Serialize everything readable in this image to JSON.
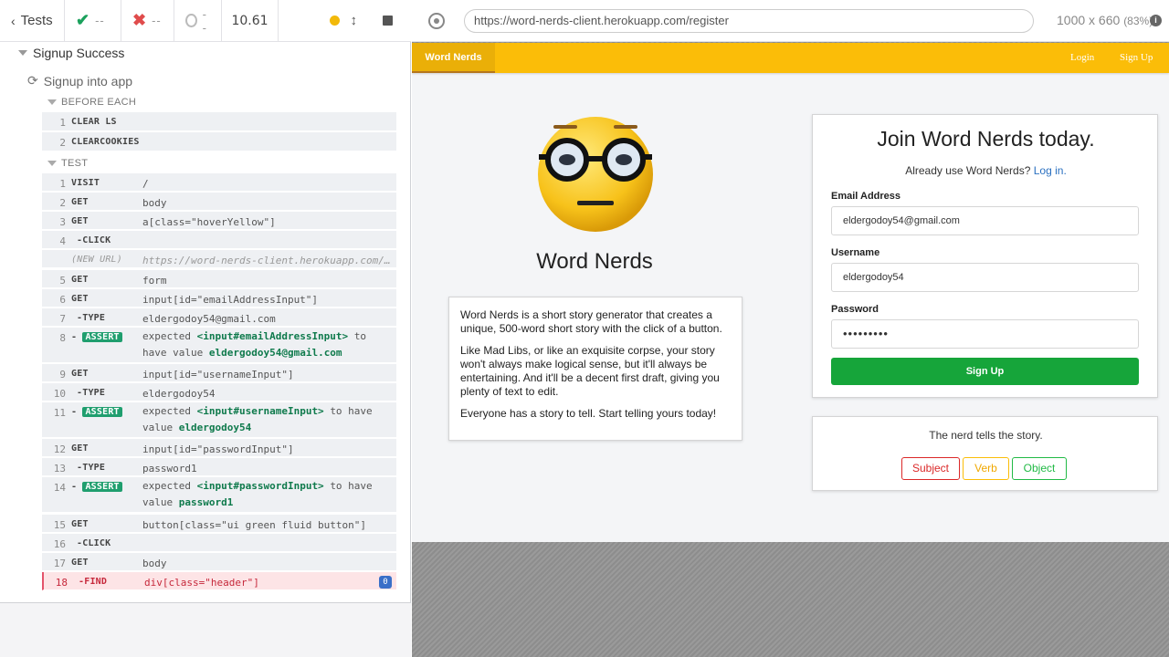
{
  "reporter": {
    "tests_label": "Tests",
    "passed": "--",
    "failed": "--",
    "pending": "--",
    "duration": "10.61",
    "suite_title": "Signup Success",
    "test_title": "Signup into app",
    "before_each_label": "BEFORE EACH",
    "test_label": "TEST",
    "before_each": [
      {
        "num": "1",
        "name": "CLEAR LS",
        "msg": ""
      },
      {
        "num": "2",
        "name": "CLEARCOOKIES",
        "msg": ""
      }
    ],
    "commands": [
      {
        "num": "1",
        "name": "VISIT",
        "msg": "/"
      },
      {
        "num": "2",
        "name": "GET",
        "msg": "body"
      },
      {
        "num": "3",
        "name": "GET",
        "msg": "a[class=\"hoverYellow\"]"
      },
      {
        "num": "4",
        "name": "-CLICK",
        "msg": ""
      },
      {
        "num": "",
        "name": "(NEW URL)",
        "msg": "https://word-nerds-client.herokuapp.com/…"
      },
      {
        "num": "5",
        "name": "GET",
        "msg": "form"
      },
      {
        "num": "6",
        "name": "GET",
        "msg": "input[id=\"emailAddressInput\"]"
      },
      {
        "num": "7",
        "name": "-TYPE",
        "msg": "eldergodoy54@gmail.com"
      },
      {
        "num": "8",
        "name": "ASSERT",
        "msg_pre": "expected",
        "msg_sel": "<input#emailAddressInput>",
        "msg_mid": "to have value",
        "msg_val": "eldergodoy54@gmail.com"
      },
      {
        "num": "9",
        "name": "GET",
        "msg": "input[id=\"usernameInput\"]"
      },
      {
        "num": "10",
        "name": "-TYPE",
        "msg": "eldergodoy54"
      },
      {
        "num": "11",
        "name": "ASSERT",
        "msg_pre": "expected",
        "msg_sel": "<input#usernameInput>",
        "msg_mid": "to have value",
        "msg_val": "eldergodoy54"
      },
      {
        "num": "12",
        "name": "GET",
        "msg": "input[id=\"passwordInput\"]"
      },
      {
        "num": "13",
        "name": "-TYPE",
        "msg": "password1"
      },
      {
        "num": "14",
        "name": "ASSERT",
        "msg_pre": "expected",
        "msg_sel": "<input#passwordInput>",
        "msg_mid": "to have value",
        "msg_val": "password1"
      },
      {
        "num": "15",
        "name": "GET",
        "msg": "button[class=\"ui green fluid button\"]"
      },
      {
        "num": "16",
        "name": "-CLICK",
        "msg": ""
      },
      {
        "num": "17",
        "name": "GET",
        "msg": "body"
      },
      {
        "num": "18",
        "name": "-FIND",
        "msg": "div[class=\"header\"]",
        "badge": "0"
      }
    ]
  },
  "browser": {
    "url": "https://word-nerds-client.herokuapp.com/register",
    "viewport": "1000 x 660",
    "scale": "(83%)",
    "info": "i"
  },
  "app": {
    "brand": "Word Nerds",
    "nav_login": "Login",
    "nav_signup": "Sign Up",
    "title": "Word Nerds",
    "description": [
      "Word Nerds is a short story generator that creates a unique, 500-word short story with the click of a button.",
      "Like Mad Libs, or like an exquisite corpse, your story won't always make logical sense, but it'll always be entertaining. And it'll be a decent first draft, giving you plenty of text to edit.",
      "Everyone has a story to tell. Start telling yours today!"
    ],
    "form": {
      "title": "Join Word Nerds today.",
      "subtitle": "Already use Word Nerds?",
      "login_link": "Log in.",
      "email_label": "Email Address",
      "email_value": "eldergodoy54@gmail.com",
      "username_label": "Username",
      "username_value": "eldergodoy54",
      "password_label": "Password",
      "password_value": "•••••••••",
      "submit": "Sign Up"
    },
    "tell": {
      "text": "The nerd tells the story.",
      "subject": "Subject",
      "verb": "Verb",
      "object": "Object"
    }
  },
  "colors": {
    "navbar": "#fbbd08",
    "signup_button": "#16a53a",
    "failed_row": "#fde4e6",
    "assert_badge": "#1f9e6e"
  }
}
